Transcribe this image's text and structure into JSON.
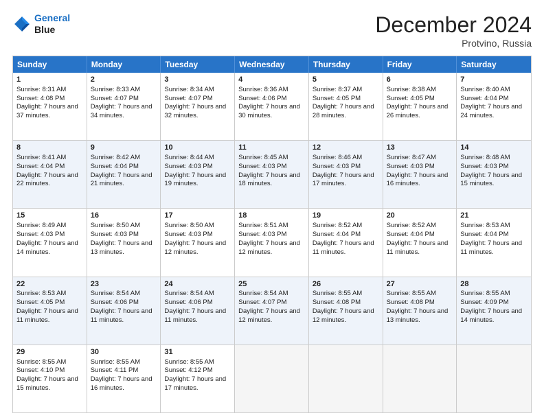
{
  "header": {
    "logo_line1": "General",
    "logo_line2": "Blue",
    "month_title": "December 2024",
    "location": "Protvino, Russia"
  },
  "days_of_week": [
    "Sunday",
    "Monday",
    "Tuesday",
    "Wednesday",
    "Thursday",
    "Friday",
    "Saturday"
  ],
  "weeks": [
    [
      {
        "day": "1",
        "sunrise": "Sunrise: 8:31 AM",
        "sunset": "Sunset: 4:08 PM",
        "daylight": "Daylight: 7 hours and 37 minutes."
      },
      {
        "day": "2",
        "sunrise": "Sunrise: 8:33 AM",
        "sunset": "Sunset: 4:07 PM",
        "daylight": "Daylight: 7 hours and 34 minutes."
      },
      {
        "day": "3",
        "sunrise": "Sunrise: 8:34 AM",
        "sunset": "Sunset: 4:07 PM",
        "daylight": "Daylight: 7 hours and 32 minutes."
      },
      {
        "day": "4",
        "sunrise": "Sunrise: 8:36 AM",
        "sunset": "Sunset: 4:06 PM",
        "daylight": "Daylight: 7 hours and 30 minutes."
      },
      {
        "day": "5",
        "sunrise": "Sunrise: 8:37 AM",
        "sunset": "Sunset: 4:05 PM",
        "daylight": "Daylight: 7 hours and 28 minutes."
      },
      {
        "day": "6",
        "sunrise": "Sunrise: 8:38 AM",
        "sunset": "Sunset: 4:05 PM",
        "daylight": "Daylight: 7 hours and 26 minutes."
      },
      {
        "day": "7",
        "sunrise": "Sunrise: 8:40 AM",
        "sunset": "Sunset: 4:04 PM",
        "daylight": "Daylight: 7 hours and 24 minutes."
      }
    ],
    [
      {
        "day": "8",
        "sunrise": "Sunrise: 8:41 AM",
        "sunset": "Sunset: 4:04 PM",
        "daylight": "Daylight: 7 hours and 22 minutes."
      },
      {
        "day": "9",
        "sunrise": "Sunrise: 8:42 AM",
        "sunset": "Sunset: 4:04 PM",
        "daylight": "Daylight: 7 hours and 21 minutes."
      },
      {
        "day": "10",
        "sunrise": "Sunrise: 8:44 AM",
        "sunset": "Sunset: 4:03 PM",
        "daylight": "Daylight: 7 hours and 19 minutes."
      },
      {
        "day": "11",
        "sunrise": "Sunrise: 8:45 AM",
        "sunset": "Sunset: 4:03 PM",
        "daylight": "Daylight: 7 hours and 18 minutes."
      },
      {
        "day": "12",
        "sunrise": "Sunrise: 8:46 AM",
        "sunset": "Sunset: 4:03 PM",
        "daylight": "Daylight: 7 hours and 17 minutes."
      },
      {
        "day": "13",
        "sunrise": "Sunrise: 8:47 AM",
        "sunset": "Sunset: 4:03 PM",
        "daylight": "Daylight: 7 hours and 16 minutes."
      },
      {
        "day": "14",
        "sunrise": "Sunrise: 8:48 AM",
        "sunset": "Sunset: 4:03 PM",
        "daylight": "Daylight: 7 hours and 15 minutes."
      }
    ],
    [
      {
        "day": "15",
        "sunrise": "Sunrise: 8:49 AM",
        "sunset": "Sunset: 4:03 PM",
        "daylight": "Daylight: 7 hours and 14 minutes."
      },
      {
        "day": "16",
        "sunrise": "Sunrise: 8:50 AM",
        "sunset": "Sunset: 4:03 PM",
        "daylight": "Daylight: 7 hours and 13 minutes."
      },
      {
        "day": "17",
        "sunrise": "Sunrise: 8:50 AM",
        "sunset": "Sunset: 4:03 PM",
        "daylight": "Daylight: 7 hours and 12 minutes."
      },
      {
        "day": "18",
        "sunrise": "Sunrise: 8:51 AM",
        "sunset": "Sunset: 4:03 PM",
        "daylight": "Daylight: 7 hours and 12 minutes."
      },
      {
        "day": "19",
        "sunrise": "Sunrise: 8:52 AM",
        "sunset": "Sunset: 4:04 PM",
        "daylight": "Daylight: 7 hours and 11 minutes."
      },
      {
        "day": "20",
        "sunrise": "Sunrise: 8:52 AM",
        "sunset": "Sunset: 4:04 PM",
        "daylight": "Daylight: 7 hours and 11 minutes."
      },
      {
        "day": "21",
        "sunrise": "Sunrise: 8:53 AM",
        "sunset": "Sunset: 4:04 PM",
        "daylight": "Daylight: 7 hours and 11 minutes."
      }
    ],
    [
      {
        "day": "22",
        "sunrise": "Sunrise: 8:53 AM",
        "sunset": "Sunset: 4:05 PM",
        "daylight": "Daylight: 7 hours and 11 minutes."
      },
      {
        "day": "23",
        "sunrise": "Sunrise: 8:54 AM",
        "sunset": "Sunset: 4:06 PM",
        "daylight": "Daylight: 7 hours and 11 minutes."
      },
      {
        "day": "24",
        "sunrise": "Sunrise: 8:54 AM",
        "sunset": "Sunset: 4:06 PM",
        "daylight": "Daylight: 7 hours and 11 minutes."
      },
      {
        "day": "25",
        "sunrise": "Sunrise: 8:54 AM",
        "sunset": "Sunset: 4:07 PM",
        "daylight": "Daylight: 7 hours and 12 minutes."
      },
      {
        "day": "26",
        "sunrise": "Sunrise: 8:55 AM",
        "sunset": "Sunset: 4:08 PM",
        "daylight": "Daylight: 7 hours and 12 minutes."
      },
      {
        "day": "27",
        "sunrise": "Sunrise: 8:55 AM",
        "sunset": "Sunset: 4:08 PM",
        "daylight": "Daylight: 7 hours and 13 minutes."
      },
      {
        "day": "28",
        "sunrise": "Sunrise: 8:55 AM",
        "sunset": "Sunset: 4:09 PM",
        "daylight": "Daylight: 7 hours and 14 minutes."
      }
    ],
    [
      {
        "day": "29",
        "sunrise": "Sunrise: 8:55 AM",
        "sunset": "Sunset: 4:10 PM",
        "daylight": "Daylight: 7 hours and 15 minutes."
      },
      {
        "day": "30",
        "sunrise": "Sunrise: 8:55 AM",
        "sunset": "Sunset: 4:11 PM",
        "daylight": "Daylight: 7 hours and 16 minutes."
      },
      {
        "day": "31",
        "sunrise": "Sunrise: 8:55 AM",
        "sunset": "Sunset: 4:12 PM",
        "daylight": "Daylight: 7 hours and 17 minutes."
      },
      {
        "day": "",
        "sunrise": "",
        "sunset": "",
        "daylight": ""
      },
      {
        "day": "",
        "sunrise": "",
        "sunset": "",
        "daylight": ""
      },
      {
        "day": "",
        "sunrise": "",
        "sunset": "",
        "daylight": ""
      },
      {
        "day": "",
        "sunrise": "",
        "sunset": "",
        "daylight": ""
      }
    ]
  ]
}
